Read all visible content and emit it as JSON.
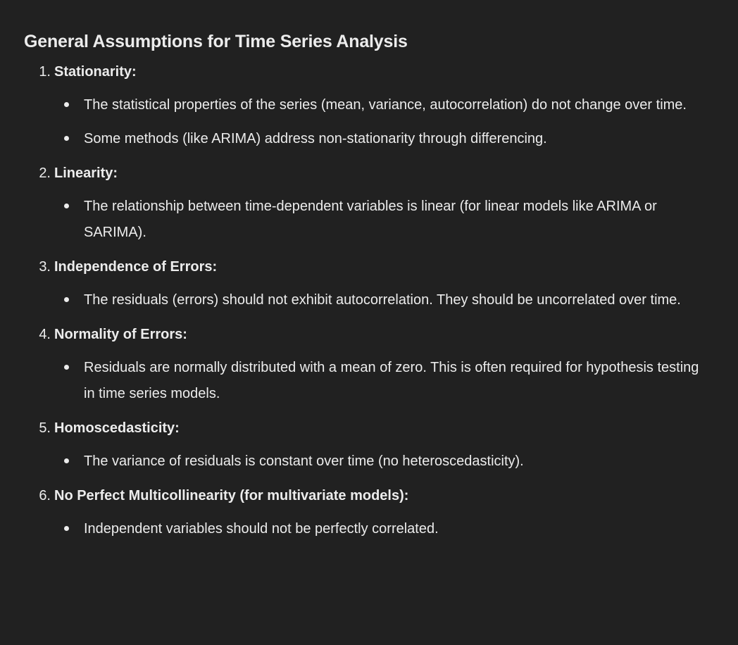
{
  "heading": "General Assumptions for Time Series Analysis",
  "sections": [
    {
      "number": "1.",
      "title": "Stationarity:",
      "bullets": [
        "The statistical properties of the series (mean, variance, autocorrelation) do not change over time.",
        "Some methods (like ARIMA) address non-stationarity through differencing."
      ]
    },
    {
      "number": "2.",
      "title": "Linearity:",
      "bullets": [
        "The relationship between time-dependent variables is linear (for linear models like ARIMA or SARIMA)."
      ]
    },
    {
      "number": "3.",
      "title": "Independence of Errors:",
      "bullets": [
        "The residuals (errors) should not exhibit autocorrelation. They should be uncorrelated over time."
      ]
    },
    {
      "number": "4.",
      "title": "Normality of Errors:",
      "bullets": [
        "Residuals are normally distributed with a mean of zero. This is often required for hypothesis testing in time series models."
      ]
    },
    {
      "number": "5.",
      "title": "Homoscedasticity:",
      "bullets": [
        "The variance of residuals is constant over time (no heteroscedasticity)."
      ]
    },
    {
      "number": "6.",
      "title": "No Perfect Multicollinearity (for multivariate models):",
      "bullets": [
        "Independent variables should not be perfectly correlated."
      ]
    }
  ]
}
